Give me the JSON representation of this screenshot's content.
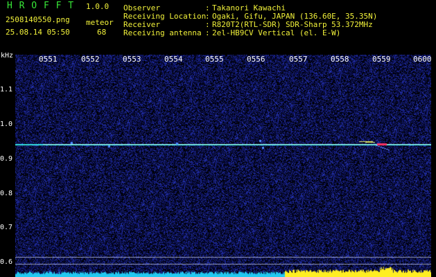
{
  "app": {
    "name": "H R O F F T",
    "version": "1.0.0"
  },
  "file": {
    "name": "2508140550.png",
    "datetime": "25.08.14 05:50"
  },
  "meteor": {
    "label": "meteor",
    "count": "68"
  },
  "header": [
    {
      "label": "Observer",
      "sep": ":",
      "value": "Takanori Kawachi"
    },
    {
      "label": "Receiving Location",
      "sep": ":",
      "value": "Ogaki, Gifu, JAPAN (136.60E, 35.35N)"
    },
    {
      "label": "Receiver",
      "sep": ":",
      "value": "R820T2(RTL-SDR) SDR-Sharp 53.372MHz"
    },
    {
      "label": "Receiving antenna",
      "sep": ":",
      "value": "2el-HB9CV Vertical (el. E-W)"
    }
  ],
  "axis": {
    "unit": "kHz",
    "y_ticks": [
      "1.1",
      "1.0",
      "0.9",
      "0.8",
      "0.7",
      "0.6"
    ],
    "x_ticks": [
      "0551",
      "0552",
      "0553",
      "0554",
      "0555",
      "0556",
      "0557",
      "0558",
      "0559",
      "0600"
    ]
  },
  "colors": {
    "background": "#000000",
    "noise": "#1e2a9a",
    "carrier": "#34e0e6",
    "meteor_echo": "#ff3060",
    "level_low": "#22c8f0",
    "level_high": "#ffee22"
  }
}
